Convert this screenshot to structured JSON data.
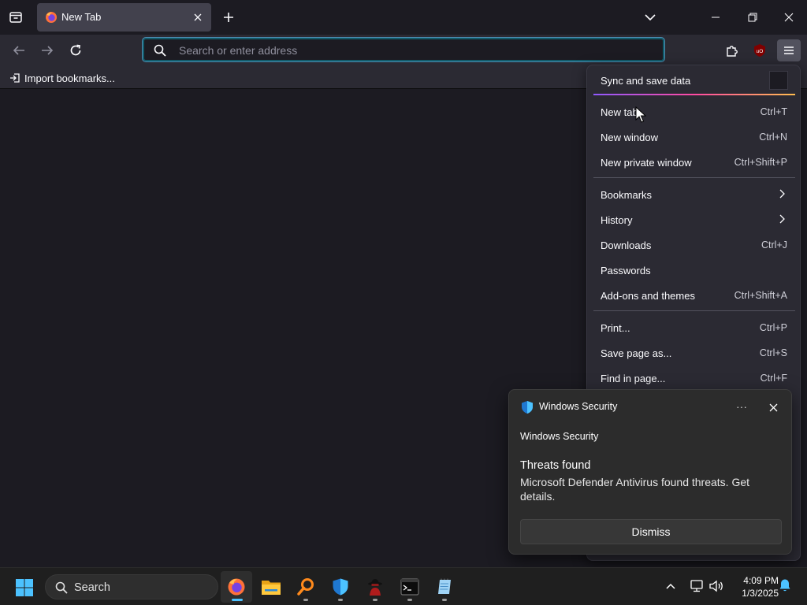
{
  "browser": {
    "tab": {
      "title": "New Tab"
    },
    "urlbar": {
      "placeholder": "Search or enter address",
      "value": ""
    },
    "bookmarks_toolbar": {
      "import_label": "Import bookmarks..."
    },
    "extensions": {
      "ublock_badge": "uO"
    }
  },
  "app_menu": {
    "sync": {
      "label": "Sync and save data"
    },
    "items": [
      {
        "label": "New tab",
        "shortcut": "Ctrl+T"
      },
      {
        "label": "New window",
        "shortcut": "Ctrl+N"
      },
      {
        "label": "New private window",
        "shortcut": "Ctrl+Shift+P"
      },
      {
        "label": "Bookmarks",
        "shortcut": ""
      },
      {
        "label": "History",
        "shortcut": ""
      },
      {
        "label": "Downloads",
        "shortcut": "Ctrl+J"
      },
      {
        "label": "Passwords",
        "shortcut": ""
      },
      {
        "label": "Add-ons and themes",
        "shortcut": "Ctrl+Shift+A"
      },
      {
        "label": "Print...",
        "shortcut": "Ctrl+P"
      },
      {
        "label": "Save page as...",
        "shortcut": "Ctrl+S"
      },
      {
        "label": "Find in page...",
        "shortcut": "Ctrl+F"
      }
    ]
  },
  "notification": {
    "app_name": "Windows Security",
    "header": "Windows Security",
    "title": "Threats found",
    "body": "Microsoft Defender Antivirus found threats. Get details.",
    "dismiss_label": "Dismiss"
  },
  "taskbar": {
    "search_label": "Search",
    "apps": [
      "firefox-icon",
      "file-explorer-icon",
      "search-tool-icon",
      "windows-security-icon",
      "spy-app-icon",
      "terminal-icon",
      "notepad-icon"
    ],
    "clock": {
      "time": "4:09 PM",
      "date": "1/3/2025"
    }
  },
  "colors": {
    "accent": "#4cc2ff",
    "defender_blue": "#1f78d1",
    "menu_bg": "#2b2a33",
    "content_bg": "#1c1b22"
  }
}
